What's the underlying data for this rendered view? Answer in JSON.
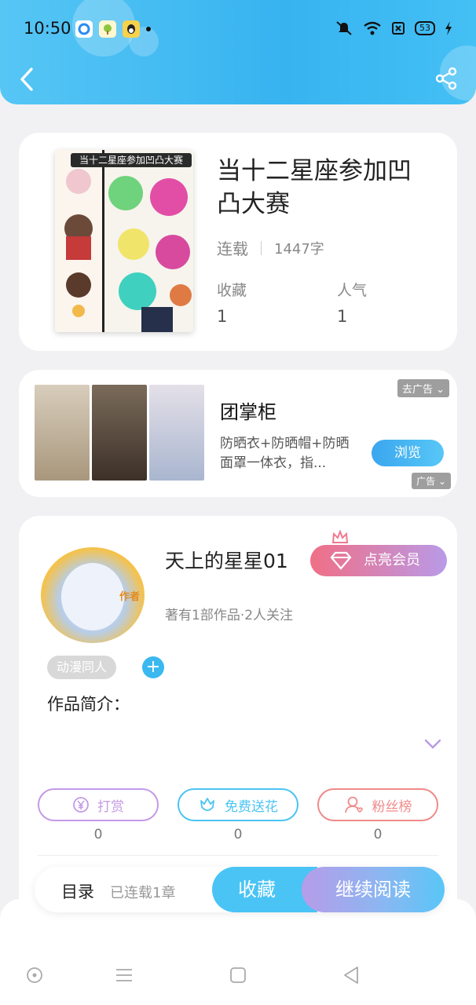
{
  "status_bar": {
    "time": "10:50",
    "battery": "53"
  },
  "colors": {
    "accent": "#3bb8ef",
    "vip_start": "#f06f86",
    "vip_end": "#b99ae8"
  },
  "book": {
    "title": "当十二星座参加凹凸大赛",
    "cover_banner": "当十二星座参加凹凸大赛",
    "status": "连载",
    "word_count": "1447字",
    "favorites_label": "收藏",
    "favorites_value": "1",
    "popularity_label": "人气",
    "popularity_value": "1"
  },
  "ad": {
    "title": "团掌柜",
    "description": "防晒衣+防晒帽+防晒面罩一体衣，指...",
    "remove_label": "去广告",
    "browse_label": "浏览",
    "tag_label": "广告"
  },
  "author": {
    "badge": "作者",
    "name": "天上的星星01",
    "vip_label": "点亮会员",
    "stats": "著有1部作品·2人关注",
    "tag": "动漫同人",
    "add_tag": "+",
    "intro_label": "作品简介："
  },
  "actions": [
    {
      "label": "打赏",
      "count": "0",
      "icon": "yen-coin-icon",
      "color": "#c49ae6"
    },
    {
      "label": "免费送花",
      "count": "0",
      "icon": "flower-icon",
      "color": "#4cc4f2"
    },
    {
      "label": "粉丝榜",
      "count": "0",
      "icon": "fan-ranking-icon",
      "color": "#f08a8a"
    }
  ],
  "bottom_bar": {
    "toc_label": "目录",
    "toc_sub": "已连载1章",
    "favorite_label": "收藏",
    "continue_label": "继续阅读"
  }
}
